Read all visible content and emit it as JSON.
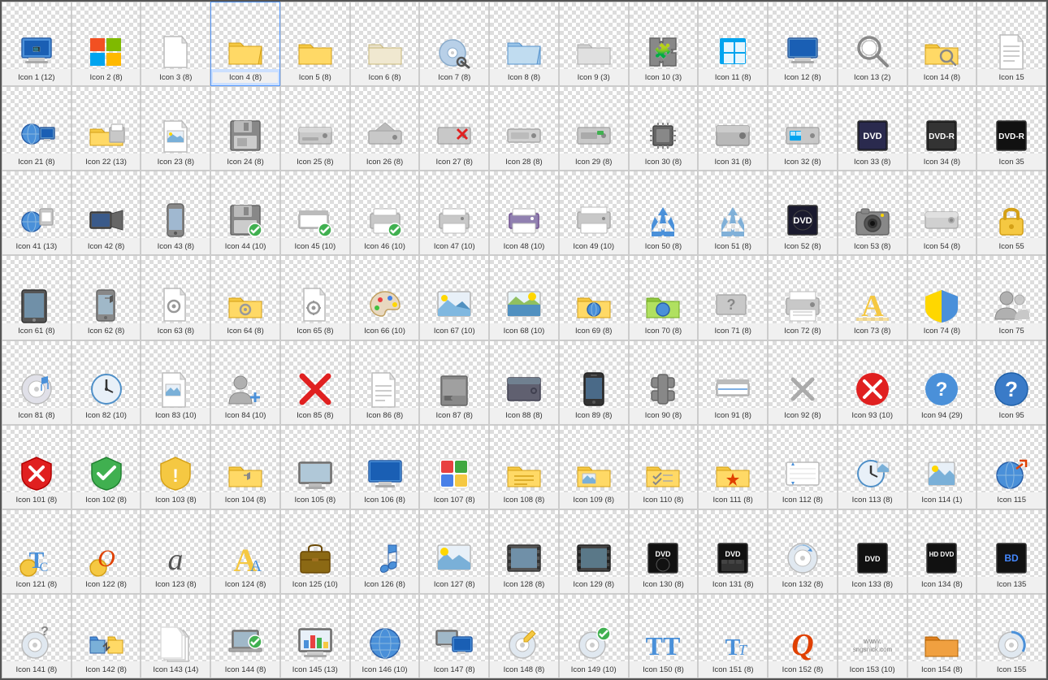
{
  "icons": [
    {
      "id": 1,
      "label": "Icon 1 (12)",
      "type": "monitor-remote"
    },
    {
      "id": 2,
      "label": "Icon 2 (8)",
      "type": "windows-logo"
    },
    {
      "id": 3,
      "label": "Icon 3 (8)",
      "type": "blank-file"
    },
    {
      "id": 4,
      "label": "Icon 4 (8)",
      "type": "folder-open-yellow",
      "selected": true
    },
    {
      "id": 5,
      "label": "Icon 5 (8)",
      "type": "folder-yellow"
    },
    {
      "id": 6,
      "label": "Icon 6 (8)",
      "type": "folder-light"
    },
    {
      "id": 7,
      "label": "Icon 7 (8)",
      "type": "cd-search"
    },
    {
      "id": 8,
      "label": "Icon 8 (8)",
      "type": "folder-blue-open"
    },
    {
      "id": 9,
      "label": "Icon 9 (3)",
      "type": "folder-gray"
    },
    {
      "id": 10,
      "label": "Icon 10 (3)",
      "type": "puzzle-piece"
    },
    {
      "id": 11,
      "label": "Icon 11 (8)",
      "type": "windows-square"
    },
    {
      "id": 12,
      "label": "Icon 12 (8)",
      "type": "monitor-blue"
    },
    {
      "id": 13,
      "label": "Icon 13 (2)",
      "type": "search-magnifier"
    },
    {
      "id": 14,
      "label": "Icon 14 (8)",
      "type": "folder-search"
    },
    {
      "id": 15,
      "label": "Icon 15",
      "type": "lines-document"
    },
    {
      "id": 21,
      "label": "Icon 21 (8)",
      "type": "globe-monitor"
    },
    {
      "id": 22,
      "label": "Icon 22 (13)",
      "type": "folder-printer"
    },
    {
      "id": 23,
      "label": "Icon 23 (8)",
      "type": "document-image"
    },
    {
      "id": 24,
      "label": "Icon 24 (8)",
      "type": "floppy-disk"
    },
    {
      "id": 25,
      "label": "Icon 25 (8)",
      "type": "drive-gray"
    },
    {
      "id": 26,
      "label": "Icon 26 (8)",
      "type": "disk-eject"
    },
    {
      "id": 27,
      "label": "Icon 27 (8)",
      "type": "drive-red-x"
    },
    {
      "id": 28,
      "label": "Icon 28 (8)",
      "type": "drive-small"
    },
    {
      "id": 29,
      "label": "Icon 29 (8)",
      "type": "drive-green"
    },
    {
      "id": 30,
      "label": "Icon 30 (8)",
      "type": "chip"
    },
    {
      "id": 31,
      "label": "Icon 31 (8)",
      "type": "drive-gray2"
    },
    {
      "id": 32,
      "label": "Icon 32 (8)",
      "type": "drive-windows"
    },
    {
      "id": 33,
      "label": "Icon 33 (8)",
      "type": "dvd-case"
    },
    {
      "id": 34,
      "label": "Icon 34 (8)",
      "type": "dvd-r"
    },
    {
      "id": 35,
      "label": "Icon 35",
      "type": "dvd-r2"
    },
    {
      "id": 41,
      "label": "Icon 41 (13)",
      "type": "globe-scanner"
    },
    {
      "id": 42,
      "label": "Icon 42 (8)",
      "type": "video-camera"
    },
    {
      "id": 43,
      "label": "Icon 43 (8)",
      "type": "phone-gray"
    },
    {
      "id": 44,
      "label": "Icon 44 (10)",
      "type": "floppy-check"
    },
    {
      "id": 45,
      "label": "Icon 45 (10)",
      "type": "scanner-check"
    },
    {
      "id": 46,
      "label": "Icon 46 (10)",
      "type": "printer-check"
    },
    {
      "id": 47,
      "label": "Icon 47 (10)",
      "type": "printer-gray"
    },
    {
      "id": 48,
      "label": "Icon 48 (10)",
      "type": "printer-purple"
    },
    {
      "id": 49,
      "label": "Icon 49 (10)",
      "type": "printer-scan"
    },
    {
      "id": 50,
      "label": "Icon 50 (8)",
      "type": "recycle-blue"
    },
    {
      "id": 51,
      "label": "Icon 51 (8)",
      "type": "recycle-empty"
    },
    {
      "id": 52,
      "label": "Icon 52 (8)",
      "type": "dvd-case2"
    },
    {
      "id": 53,
      "label": "Icon 53 (8)",
      "type": "camera-gray"
    },
    {
      "id": 54,
      "label": "Icon 54 (8)",
      "type": "drive-silver"
    },
    {
      "id": 55,
      "label": "Icon 55",
      "type": "lock-yellow"
    },
    {
      "id": 61,
      "label": "Icon 61 (8)",
      "type": "tablet-dark"
    },
    {
      "id": 62,
      "label": "Icon 62 (8)",
      "type": "phone-music"
    },
    {
      "id": 63,
      "label": "Icon 63 (8)",
      "type": "document-gears"
    },
    {
      "id": 64,
      "label": "Icon 64 (8)",
      "type": "folder-gears"
    },
    {
      "id": 65,
      "label": "Icon 65 (8)",
      "type": "file-gears"
    },
    {
      "id": 66,
      "label": "Icon 66 (10)",
      "type": "paint-palette"
    },
    {
      "id": 67,
      "label": "Icon 67 (10)",
      "type": "photo-mountain"
    },
    {
      "id": 68,
      "label": "Icon 68 (10)",
      "type": "photo-lake"
    },
    {
      "id": 69,
      "label": "Icon 69 (8)",
      "type": "folder-globe"
    },
    {
      "id": 70,
      "label": "Icon 70 (8)",
      "type": "folder-globe2"
    },
    {
      "id": 71,
      "label": "Icon 71 (8)",
      "type": "drive-question"
    },
    {
      "id": 72,
      "label": "Icon 72 (8)",
      "type": "printer-large"
    },
    {
      "id": 73,
      "label": "Icon 73 (8)",
      "type": "font-a-yellow"
    },
    {
      "id": 74,
      "label": "Icon 74 (8)",
      "type": "shield-blue"
    },
    {
      "id": 75,
      "label": "Icon 75",
      "type": "users-gray"
    },
    {
      "id": 81,
      "label": "Icon 81 (8)",
      "type": "cd-music"
    },
    {
      "id": 82,
      "label": "Icon 82 (10)",
      "type": "clock-sync"
    },
    {
      "id": 83,
      "label": "Icon 83 (10)",
      "type": "document-image2"
    },
    {
      "id": 84,
      "label": "Icon 84 (10)",
      "type": "users-add"
    },
    {
      "id": 85,
      "label": "Icon 85 (8)",
      "type": "red-x-large"
    },
    {
      "id": 86,
      "label": "Icon 86 (8)",
      "type": "document-list"
    },
    {
      "id": 87,
      "label": "Icon 87 (8)",
      "type": "drive-removable"
    },
    {
      "id": 88,
      "label": "Icon 88 (8)",
      "type": "drive-dark"
    },
    {
      "id": 89,
      "label": "Icon 89 (8)",
      "type": "phone-black"
    },
    {
      "id": 90,
      "label": "Icon 90 (8)",
      "type": "tools-cross"
    },
    {
      "id": 91,
      "label": "Icon 91 (8)",
      "type": "scanner-flat"
    },
    {
      "id": 92,
      "label": "Icon 92 (8)",
      "type": "gray-x"
    },
    {
      "id": 93,
      "label": "Icon 93 (10)",
      "type": "red-circle-x"
    },
    {
      "id": 94,
      "label": "Icon 94 (29)",
      "type": "blue-question"
    },
    {
      "id": 95,
      "label": "Icon 95",
      "type": "blue-question2"
    },
    {
      "id": 101,
      "label": "Icon 101 (8)",
      "type": "red-shield-x"
    },
    {
      "id": 102,
      "label": "Icon 102 (8)",
      "type": "green-shield-check"
    },
    {
      "id": 103,
      "label": "Icon 103 (8)",
      "type": "yellow-shield-warn"
    },
    {
      "id": 104,
      "label": "Icon 104 (8)",
      "type": "folder-music"
    },
    {
      "id": 105,
      "label": "Icon 105 (8)",
      "type": "monitor-flat"
    },
    {
      "id": 106,
      "label": "Icon 106 (8)",
      "type": "monitor-blue2"
    },
    {
      "id": 107,
      "label": "Icon 107 (8)",
      "type": "colorful-app"
    },
    {
      "id": 108,
      "label": "Icon 108 (8)",
      "type": "folder-document"
    },
    {
      "id": 109,
      "label": "Icon 109 (8)",
      "type": "folder-photo"
    },
    {
      "id": 110,
      "label": "Icon 110 (8)",
      "type": "folder-checklist"
    },
    {
      "id": 111,
      "label": "Icon 111 (8)",
      "type": "folder-star"
    },
    {
      "id": 112,
      "label": "Icon 112 (8)",
      "type": "list-arrows"
    },
    {
      "id": 113,
      "label": "Icon 113 (8)",
      "type": "clock-photo"
    },
    {
      "id": 114,
      "label": "Icon 114 (1)",
      "type": "photo-small"
    },
    {
      "id": 115,
      "label": "Icon 115",
      "type": "globe-arrow"
    },
    {
      "id": 121,
      "label": "Icon 121 (8)",
      "type": "font-tc"
    },
    {
      "id": 122,
      "label": "Icon 122 (8)",
      "type": "font-o-medal"
    },
    {
      "id": 123,
      "label": "Icon 123 (8)",
      "type": "font-a-italic"
    },
    {
      "id": 124,
      "label": "Icon 124 (8)",
      "type": "font-a-large"
    },
    {
      "id": 125,
      "label": "Icon 125 (10)",
      "type": "briefcase"
    },
    {
      "id": 126,
      "label": "Icon 126 (8)",
      "type": "music-note"
    },
    {
      "id": 127,
      "label": "Icon 127 (8)",
      "type": "photo-landscape"
    },
    {
      "id": 128,
      "label": "Icon 128 (8)",
      "type": "film-strip"
    },
    {
      "id": 129,
      "label": "Icon 129 (8)",
      "type": "film-strip2"
    },
    {
      "id": 130,
      "label": "Icon 130 (8)",
      "type": "dvd-video"
    },
    {
      "id": 131,
      "label": "Icon 131 (8)",
      "type": "dvd-film"
    },
    {
      "id": 132,
      "label": "Icon 132 (8)",
      "type": "cd-music2"
    },
    {
      "id": 133,
      "label": "Icon 133 (8)",
      "type": "dvd-data"
    },
    {
      "id": 134,
      "label": "Icon 134 (8)",
      "type": "hd-dvd"
    },
    {
      "id": 135,
      "label": "Icon 135",
      "type": "bd-disc"
    },
    {
      "id": 141,
      "label": "Icon 141 (8)",
      "type": "cd-question"
    },
    {
      "id": 142,
      "label": "Icon 142 (8)",
      "type": "folders-sync"
    },
    {
      "id": 143,
      "label": "Icon 143 (14)",
      "type": "documents-stack"
    },
    {
      "id": 144,
      "label": "Icon 144 (8)",
      "type": "laptop-check"
    },
    {
      "id": 145,
      "label": "Icon 145 (13)",
      "type": "chart-monitor"
    },
    {
      "id": 146,
      "label": "Icon 146 (10)",
      "type": "globe-network"
    },
    {
      "id": 147,
      "label": "Icon 147 (8)",
      "type": "monitors-two"
    },
    {
      "id": 148,
      "label": "Icon 148 (8)",
      "type": "cd-write"
    },
    {
      "id": 149,
      "label": "Icon 149 (10)",
      "type": "cd-check"
    },
    {
      "id": 150,
      "label": "Icon 150 (8)",
      "type": "font-tt"
    },
    {
      "id": 151,
      "label": "Icon 151 (8)",
      "type": "font-tt2"
    },
    {
      "id": 152,
      "label": "Icon 152 (8)",
      "type": "font-q"
    },
    {
      "id": 153,
      "label": "Icon 153 (10)",
      "type": "watermark-site"
    },
    {
      "id": 154,
      "label": "Icon 154 (8)",
      "type": "folder-orange"
    },
    {
      "id": 155,
      "label": "Icon 155",
      "type": "cd-partial"
    }
  ]
}
